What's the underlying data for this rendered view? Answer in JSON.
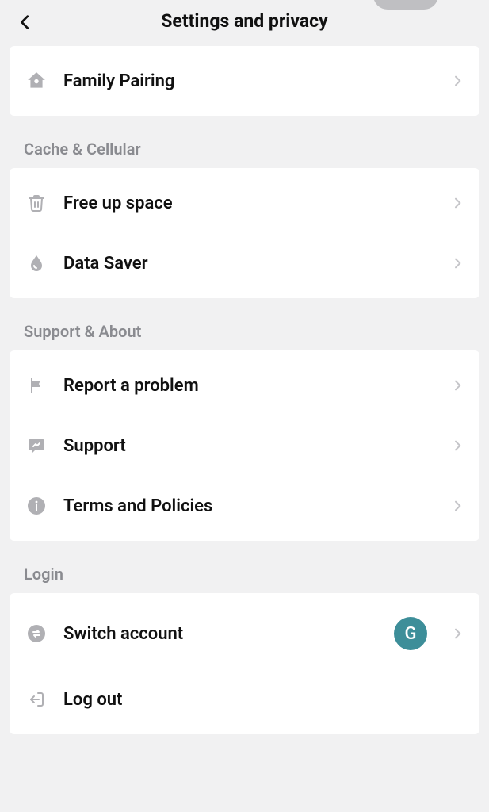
{
  "header": {
    "title": "Settings and privacy"
  },
  "sections": {
    "top": {
      "family_pairing": "Family Pairing"
    },
    "cache": {
      "header": "Cache & Cellular",
      "free_up_space": "Free up space",
      "data_saver": "Data Saver"
    },
    "support": {
      "header": "Support & About",
      "report_problem": "Report a problem",
      "support": "Support",
      "terms": "Terms and Policies"
    },
    "login": {
      "header": "Login",
      "switch_account": "Switch account",
      "avatar_letter": "G",
      "log_out": "Log out"
    }
  }
}
